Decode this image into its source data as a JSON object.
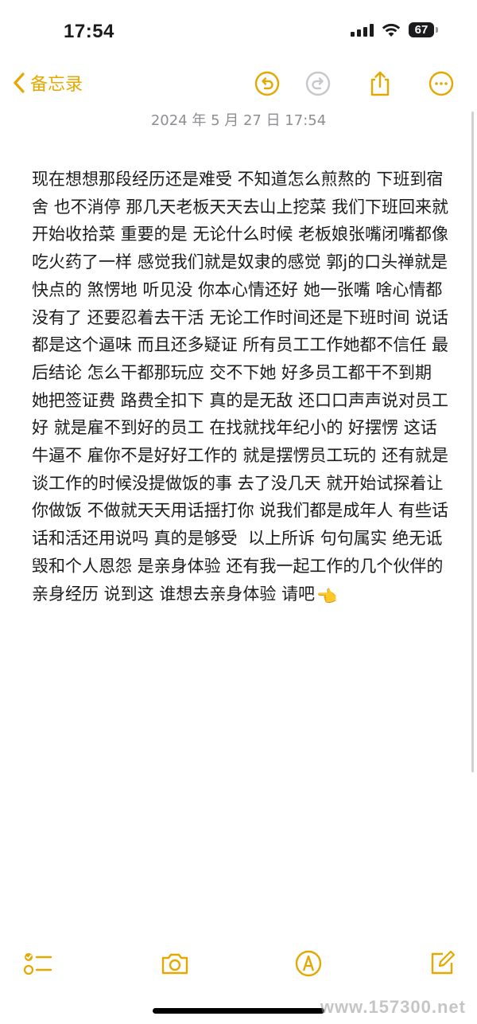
{
  "status_bar": {
    "time": "17:54",
    "battery": "67"
  },
  "nav": {
    "back_label": "备忘录",
    "icons": [
      "undo-icon",
      "redo-icon",
      "share-icon",
      "more-icon"
    ]
  },
  "note": {
    "date": "2024 年 5 月 27 日 17:54",
    "text": "现在想想那段经历还是难受 不知道怎么煎熬的 下班到宿舍 也不消停 那几天老板天天去山上挖菜 我们下班回来就开始收拾菜 重要的是 无论什么时候 老板娘张嘴闭嘴都像吃火药了一样 感觉我们就是奴隶的感觉 郭j的口头禅就是 快点的 煞愣地 听见没 你本心情还好 她一张嘴 啥心情都没有了 还要忍着去干活 无论工作时间还是下班时间 说话都是这个逼味 而且还多疑证 所有员工工作她都不信任 最后结论 怎么干都那玩应 交不下她 好多员工都干不到期 她把签证费 路费全扣下 真的是无敌 还口口声声说对员工好 就是雇不到好的员工 在找就找年纪小的 好摆愣 这话牛逼不 雇你不是好好工作的 就是摆愣员工玩的 还有就是 谈工作的时候没提做饭的事 去了没几天 就开始试探着让你做饭 不做就天天用话揺打你 说我们都是成年人 有些话话和活还用说吗 真的是够受  以上所诉 句句属实 绝无诋毁和个人恩怨 是亲身体验 还有我一起工作的几个伙伴的亲身经历 说到这 谁想去亲身体验 请吧",
    "emoji": "👈"
  },
  "toolbar": {
    "icons": [
      "checklist-icon",
      "camera-icon",
      "markup-icon",
      "compose-icon"
    ]
  },
  "watermark": "www.157300.net",
  "colors": {
    "accent": "#e5a800",
    "text": "#1c1c1e",
    "secondary_text": "#8e8e93",
    "background": "#ffffff"
  }
}
